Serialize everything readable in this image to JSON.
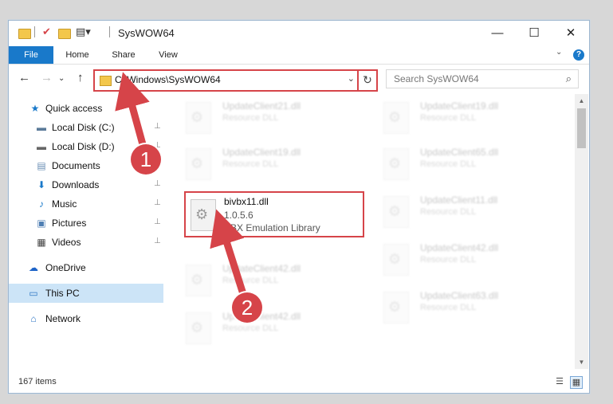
{
  "window": {
    "title": "SysWOW64",
    "controls": {
      "minimize": "—",
      "maximize": "☐",
      "close": "✕"
    }
  },
  "ribbon": {
    "tabs": [
      "File",
      "Home",
      "Share",
      "View"
    ],
    "expand": "⌄",
    "help": "?"
  },
  "nav": {
    "back": "←",
    "forward": "→",
    "recent": "⌄",
    "up": "↑",
    "address": "C:\\Windows\\SysWOW64",
    "address_dropdown": "⌄",
    "refresh": "↻",
    "search_placeholder": "Search SysWOW64",
    "search_icon": "⌕"
  },
  "sidebar": {
    "items": [
      {
        "label": "Quick access",
        "icon": "★",
        "icon_color": "#1979ca",
        "pinned": false
      },
      {
        "label": "Local Disk (C:)",
        "icon": "▬",
        "icon_color": "#5b7a99",
        "pinned": true
      },
      {
        "label": "Local Disk (D:)",
        "icon": "▬",
        "icon_color": "#666666",
        "pinned": true
      },
      {
        "label": "Documents",
        "icon": "▤",
        "icon_color": "#6b8fb5",
        "pinned": true
      },
      {
        "label": "Downloads",
        "icon": "⬇",
        "icon_color": "#1979ca",
        "pinned": true
      },
      {
        "label": "Music",
        "icon": "♪",
        "icon_color": "#1979ca",
        "pinned": true
      },
      {
        "label": "Pictures",
        "icon": "▣",
        "icon_color": "#4f7fb3",
        "pinned": true
      },
      {
        "label": "Videos",
        "icon": "▦",
        "icon_color": "#444444",
        "pinned": true
      },
      {
        "label": "OneDrive",
        "icon": "☁",
        "icon_color": "#1e64c8",
        "pinned": false
      },
      {
        "label": "This PC",
        "icon": "▭",
        "icon_color": "#2f77c4",
        "pinned": false
      },
      {
        "label": "Network",
        "icon": "⌂",
        "icon_color": "#2f77c4",
        "pinned": false
      }
    ],
    "pin_glyph": "📌"
  },
  "files": {
    "blurred_left": [
      {
        "name": "UpdateClient21.dll",
        "type": "Resource DLL"
      },
      {
        "name": "UpdateClient19.dll",
        "type": "Resource DLL"
      },
      {
        "name": "UpdateClient42.dll",
        "type": "Resource DLL"
      },
      {
        "name": "UpdateClient42.dll",
        "type": "Resource DLL"
      }
    ],
    "blurred_right": [
      {
        "name": "UpdateClient19.dll",
        "type": "Resource DLL"
      },
      {
        "name": "UpdateClient65.dll",
        "type": "Resource DLL"
      },
      {
        "name": "UpdateClient11.dll",
        "type": "Resource DLL"
      },
      {
        "name": "UpdateClient42.dll",
        "type": "Resource DLL"
      },
      {
        "name": "UpdateClient63.dll",
        "type": "Resource DLL"
      }
    ],
    "highlighted": {
      "name": "bivbx11.dll",
      "version": "1.0.5.6",
      "description": "VBX Emulation Library"
    }
  },
  "status": {
    "count": "167 items",
    "view_details_icon": "☰",
    "view_tiles_icon": "▦"
  },
  "callouts": [
    "1",
    "2"
  ],
  "colors": {
    "accent": "#1979ca",
    "highlight": "#d64449",
    "selection": "#cce4f7"
  }
}
